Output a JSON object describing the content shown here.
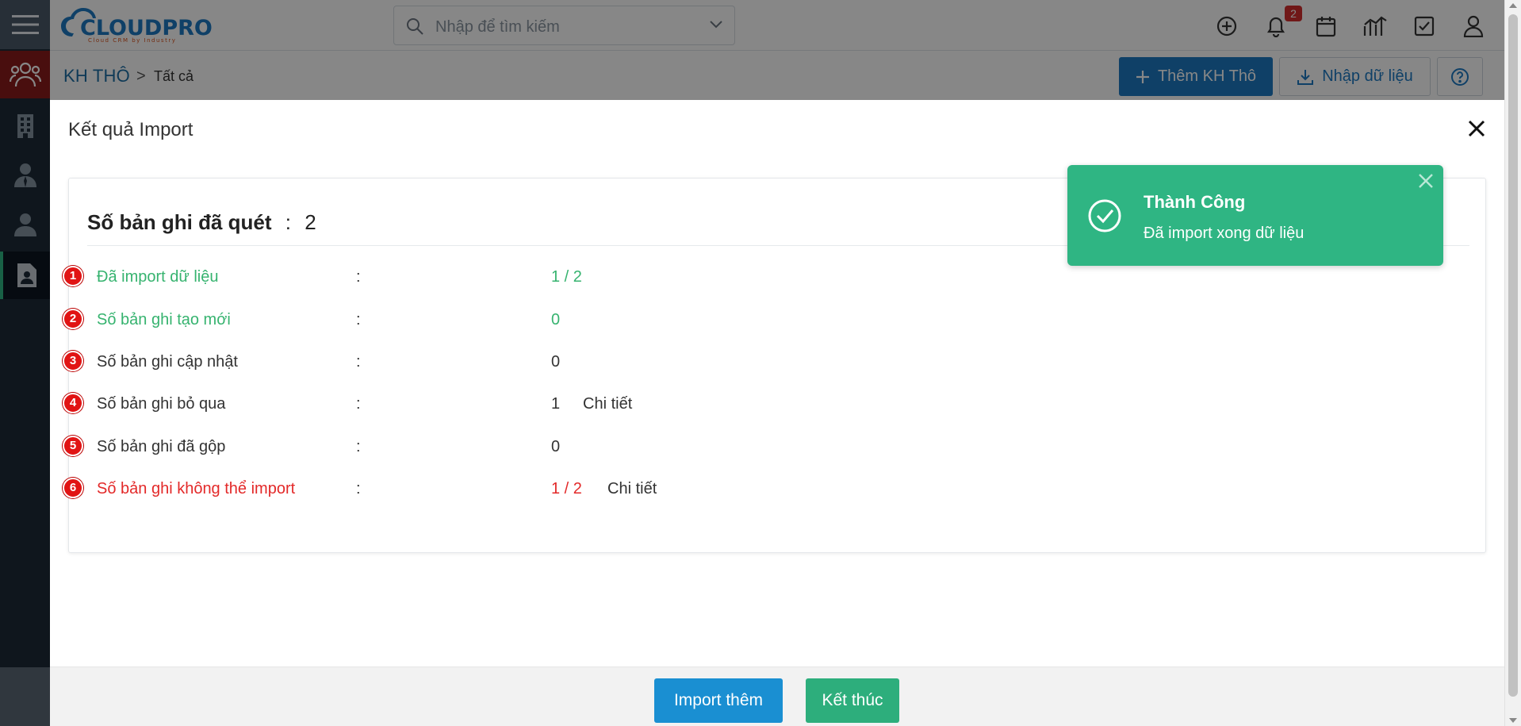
{
  "app": {
    "logo_text": "CLOUDPRO",
    "logo_tagline": "Cloud CRM by Industry"
  },
  "search": {
    "placeholder": "Nhập để tìm kiếm"
  },
  "topbar": {
    "notification_count": "2",
    "icons": [
      "add-circle-icon",
      "bell-icon",
      "calendar-icon",
      "chart-icon",
      "task-check-icon",
      "user-icon"
    ]
  },
  "sidebar": {
    "items": [
      "users-group-icon",
      "building-icon",
      "contact-icon",
      "person-icon",
      "lead-file-icon"
    ]
  },
  "breadcrumb": {
    "title": "KH THÔ",
    "separator": ">",
    "item": "Tất cả"
  },
  "toolbar": {
    "add_label": "Thêm KH Thô",
    "import_label": "Nhập dữ liệu"
  },
  "modal": {
    "title": "Kết quả Import",
    "scanned_label": "Số bản ghi đã quét",
    "scanned_colon": ":",
    "scanned_value": "2",
    "rows": [
      {
        "num": "1",
        "label": "Đã import dữ liệu",
        "colon": ":",
        "value": "1 / 2",
        "link": ""
      },
      {
        "num": "2",
        "label": "Số bản ghi tạo mới",
        "colon": ":",
        "value": "0",
        "link": ""
      },
      {
        "num": "3",
        "label": "Số bản ghi cập nhật",
        "colon": ":",
        "value": "0",
        "link": ""
      },
      {
        "num": "4",
        "label": "Số bản ghi bỏ qua",
        "colon": ":",
        "value": "1",
        "link": "Chi tiết"
      },
      {
        "num": "5",
        "label": "Số bản ghi đã gộp",
        "colon": ":",
        "value": "0",
        "link": ""
      },
      {
        "num": "6",
        "label": "Số bản ghi không thể import",
        "colon": ":",
        "value": "1 / 2",
        "link": "Chi tiết"
      }
    ],
    "import_more_label": "Import thêm",
    "finish_label": "Kết thúc"
  },
  "toast": {
    "title": "Thành Công",
    "message": "Đã import xong dữ liệu"
  },
  "colors": {
    "sidebar": "#1d2b38",
    "primary": "#1d79c2",
    "success": "#2fb583",
    "error": "#e32929",
    "positive_text": "#36b36f"
  }
}
